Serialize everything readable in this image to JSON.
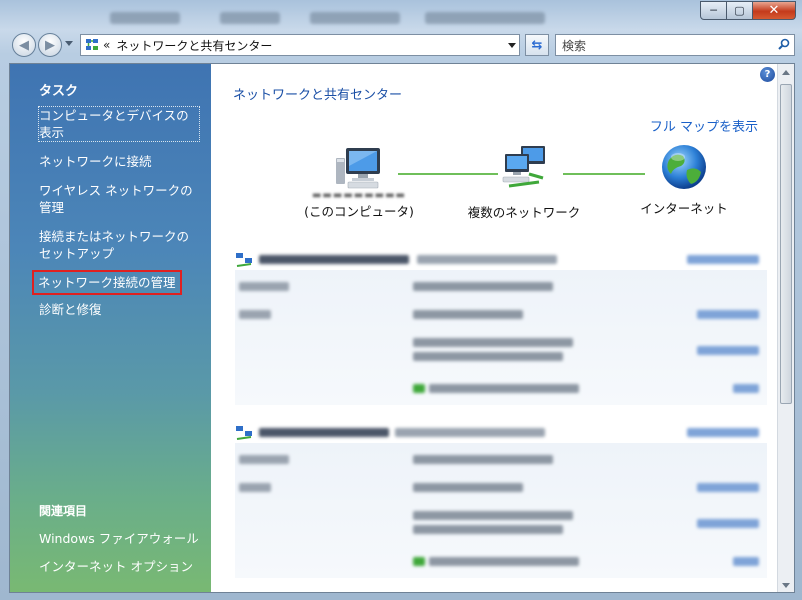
{
  "window": {
    "title_tabs_blurred": true,
    "minimize": "─",
    "maximize": "▢",
    "close": "✕"
  },
  "address_bar": {
    "chevrons": "«",
    "path": "ネットワークと共有センター"
  },
  "search": {
    "placeholder": "検索"
  },
  "sidebar": {
    "title": "タスク",
    "items": [
      {
        "label": "コンピュータとデバイスの表示"
      },
      {
        "label": "ネットワークに接続"
      },
      {
        "label": "ワイヤレス ネットワークの管理"
      },
      {
        "label": "接続またはネットワークのセットアップ"
      },
      {
        "label": "ネットワーク接続の管理"
      },
      {
        "label": "診断と修復"
      }
    ],
    "related_title": "関連項目",
    "related_items": [
      {
        "label": "Windows ファイアウォール"
      },
      {
        "label": "インターネット オプション"
      }
    ]
  },
  "content": {
    "title": "ネットワークと共有センター",
    "full_map_link": "フル マップを表示",
    "nodes": {
      "computer_caption": "(このコンピュータ)",
      "networks": "複数のネットワーク",
      "internet": "インターネット"
    }
  },
  "colors": {
    "accent_link": "#1a60c8",
    "highlight_box": "#e02020",
    "link_line": "#6fbf5a"
  }
}
